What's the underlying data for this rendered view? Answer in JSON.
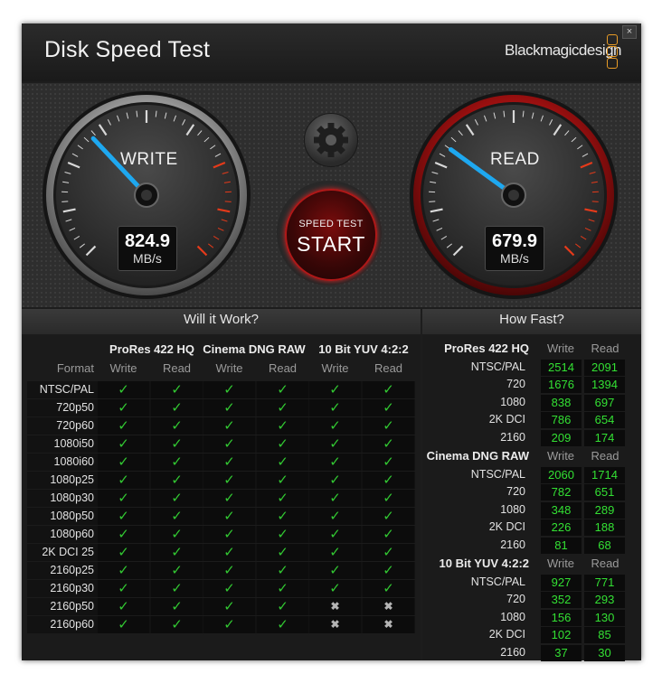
{
  "app": {
    "title": "Disk Speed Test",
    "brand": "Blackmagicdesign",
    "close_glyph": "×"
  },
  "gauges": {
    "write": {
      "label": "WRITE",
      "value": "824.9",
      "unit": "MB/s",
      "needle_fraction": 0.34
    },
    "read": {
      "label": "READ",
      "value": "679.9",
      "unit": "MB/s",
      "needle_fraction": 0.3
    }
  },
  "start_button": {
    "small": "SPEED TEST",
    "big": "START"
  },
  "settings_button": {
    "icon": "gear-icon"
  },
  "will_it_work": {
    "title": "Will it Work?",
    "format_header": "Format",
    "codecs": [
      "ProRes 422 HQ",
      "Cinema DNG RAW",
      "10 Bit YUV 4:2:2"
    ],
    "subheaders": [
      "Write",
      "Read",
      "Write",
      "Read",
      "Write",
      "Read"
    ],
    "rows": [
      {
        "format": "NTSC/PAL",
        "results": [
          1,
          1,
          1,
          1,
          1,
          1
        ]
      },
      {
        "format": "720p50",
        "results": [
          1,
          1,
          1,
          1,
          1,
          1
        ]
      },
      {
        "format": "720p60",
        "results": [
          1,
          1,
          1,
          1,
          1,
          1
        ]
      },
      {
        "format": "1080i50",
        "results": [
          1,
          1,
          1,
          1,
          1,
          1
        ]
      },
      {
        "format": "1080i60",
        "results": [
          1,
          1,
          1,
          1,
          1,
          1
        ]
      },
      {
        "format": "1080p25",
        "results": [
          1,
          1,
          1,
          1,
          1,
          1
        ]
      },
      {
        "format": "1080p30",
        "results": [
          1,
          1,
          1,
          1,
          1,
          1
        ]
      },
      {
        "format": "1080p50",
        "results": [
          1,
          1,
          1,
          1,
          1,
          1
        ]
      },
      {
        "format": "1080p60",
        "results": [
          1,
          1,
          1,
          1,
          1,
          1
        ]
      },
      {
        "format": "2K DCI 25",
        "results": [
          1,
          1,
          1,
          1,
          1,
          1
        ]
      },
      {
        "format": "2160p25",
        "results": [
          1,
          1,
          1,
          1,
          1,
          1
        ]
      },
      {
        "format": "2160p30",
        "results": [
          1,
          1,
          1,
          1,
          1,
          1
        ]
      },
      {
        "format": "2160p50",
        "results": [
          1,
          1,
          1,
          1,
          0,
          0
        ]
      },
      {
        "format": "2160p60",
        "results": [
          1,
          1,
          1,
          1,
          0,
          0
        ]
      }
    ],
    "check_glyph": "✓",
    "cross_glyph": "✖"
  },
  "how_fast": {
    "title": "How Fast?",
    "sections": [
      {
        "name": "ProRes 422 HQ",
        "write_label": "Write",
        "read_label": "Read",
        "rows": [
          {
            "format": "NTSC/PAL",
            "write": "2514",
            "read": "2091"
          },
          {
            "format": "720",
            "write": "1676",
            "read": "1394"
          },
          {
            "format": "1080",
            "write": "838",
            "read": "697"
          },
          {
            "format": "2K DCI",
            "write": "786",
            "read": "654"
          },
          {
            "format": "2160",
            "write": "209",
            "read": "174"
          }
        ]
      },
      {
        "name": "Cinema DNG RAW",
        "write_label": "Write",
        "read_label": "Read",
        "rows": [
          {
            "format": "NTSC/PAL",
            "write": "2060",
            "read": "1714"
          },
          {
            "format": "720",
            "write": "782",
            "read": "651"
          },
          {
            "format": "1080",
            "write": "348",
            "read": "289"
          },
          {
            "format": "2K DCI",
            "write": "226",
            "read": "188"
          },
          {
            "format": "2160",
            "write": "81",
            "read": "68"
          }
        ]
      },
      {
        "name": "10 Bit YUV 4:2:2",
        "write_label": "Write",
        "read_label": "Read",
        "rows": [
          {
            "format": "NTSC/PAL",
            "write": "927",
            "read": "771"
          },
          {
            "format": "720",
            "write": "352",
            "read": "293"
          },
          {
            "format": "1080",
            "write": "156",
            "read": "130"
          },
          {
            "format": "2K DCI",
            "write": "102",
            "read": "85"
          },
          {
            "format": "2160",
            "write": "37",
            "read": "30"
          }
        ]
      }
    ]
  },
  "colors": {
    "accent": "#1e9be0",
    "check": "#32c832",
    "value": "#33e033",
    "read_ring": "#b01818",
    "brand_logo": "#e89b26"
  }
}
